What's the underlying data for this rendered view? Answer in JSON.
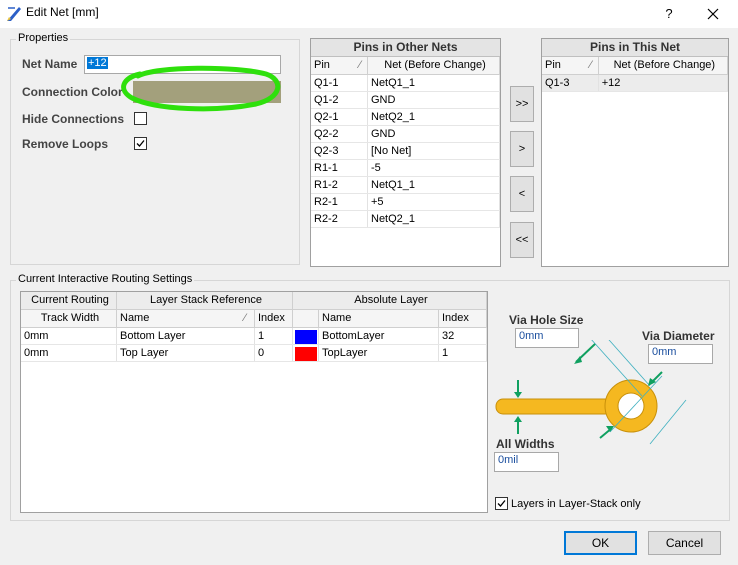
{
  "window": {
    "title": "Edit Net [mm]",
    "help": "?",
    "close": "✕"
  },
  "properties": {
    "legend": "Properties",
    "net_name_label": "Net Name",
    "net_name_value": "+12",
    "connection_color_label": "Connection Color",
    "connection_color": "#a3a07c",
    "hide_connections_label": "Hide Connections",
    "hide_connections_checked": false,
    "remove_loops_label": "Remove Loops",
    "remove_loops_checked": true,
    "annotation_color": "#2ee00c"
  },
  "pins_other": {
    "title": "Pins in Other Nets",
    "col_pin": "Pin",
    "col_net": "Net (Before Change)",
    "rows": [
      {
        "pin": "Q1-1",
        "net": "NetQ1_1"
      },
      {
        "pin": "Q1-2",
        "net": "GND"
      },
      {
        "pin": "Q2-1",
        "net": "NetQ2_1"
      },
      {
        "pin": "Q2-2",
        "net": "GND"
      },
      {
        "pin": "Q2-3",
        "net": "[No Net]"
      },
      {
        "pin": "R1-1",
        "net": "-5"
      },
      {
        "pin": "R1-2",
        "net": "NetQ1_1"
      },
      {
        "pin": "R2-1",
        "net": "+5"
      },
      {
        "pin": "R2-2",
        "net": "NetQ2_1"
      }
    ]
  },
  "pins_this": {
    "title": "Pins in This Net",
    "col_pin": "Pin",
    "col_net": "Net (Before Change)",
    "rows": [
      {
        "pin": "Q1-3",
        "net": "+12"
      }
    ]
  },
  "transfer_buttons": {
    "all_right": ">>",
    "right": ">",
    "left": "<",
    "all_left": "<<"
  },
  "routing": {
    "legend": "Current Interactive Routing Settings",
    "group_current": "Current Routing",
    "group_layer_stack": "Layer Stack Reference",
    "group_absolute": "Absolute Layer",
    "col_track_width": "Track Width",
    "col_name": "Name",
    "col_index": "Index",
    "col_abs_name": "Name",
    "col_abs_index": "Index",
    "rows": [
      {
        "track_width": "0mm",
        "name": "Bottom Layer",
        "index": "1",
        "abs_color": "#0000ff",
        "abs_name": "BottomLayer",
        "abs_index": "32"
      },
      {
        "track_width": "0mm",
        "name": "Top Layer",
        "index": "0",
        "abs_color": "#ff0000",
        "abs_name": "TopLayer",
        "abs_index": "1"
      }
    ]
  },
  "via": {
    "hole_size_label": "Via Hole Size",
    "hole_size_value": "0mm",
    "diameter_label": "Via Diameter",
    "diameter_value": "0mm",
    "all_widths_label": "All Widths",
    "all_widths_value": "0mil",
    "layers_only_label": "Layers in Layer-Stack only",
    "layers_only_checked": true,
    "via_color": "#f5b820",
    "arrow_color": "#10a060"
  },
  "footer": {
    "ok": "OK",
    "cancel": "Cancel"
  }
}
